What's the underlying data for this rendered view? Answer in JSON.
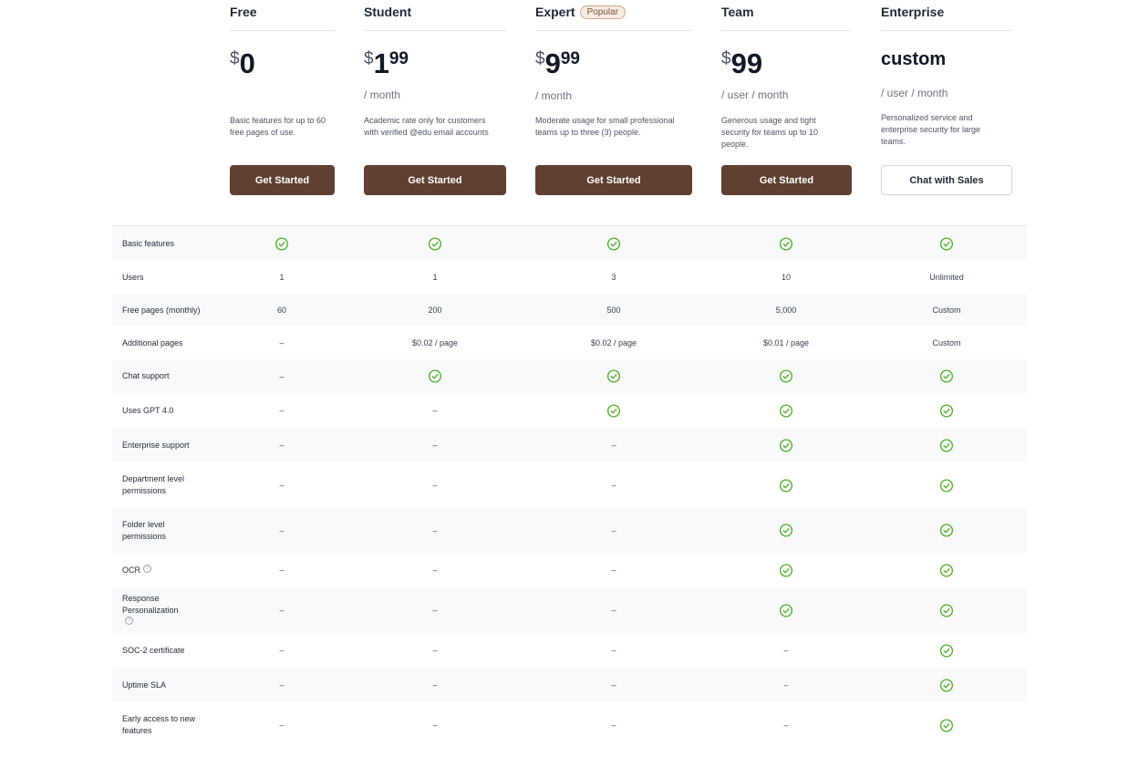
{
  "plans": [
    {
      "name": "Free",
      "badge": "",
      "currency": "$",
      "price_int": "0",
      "price_cents": "",
      "price_text": "",
      "period": "",
      "description": "Basic features for up to 60 free pages of use.",
      "cta": "Get Started",
      "cta_style": "primary"
    },
    {
      "name": "Student",
      "badge": "",
      "currency": "$",
      "price_int": "1",
      "price_cents": "99",
      "price_text": "",
      "period": "/ month",
      "description": "Academic rate only for customers with verified @edu email accounts",
      "cta": "Get Started",
      "cta_style": "primary"
    },
    {
      "name": "Expert",
      "badge": "Popular",
      "currency": "$",
      "price_int": "9",
      "price_cents": "99",
      "price_text": "",
      "period": "/ month",
      "description": "Moderate usage for small professional teams up to three (3) people.",
      "cta": "Get Started",
      "cta_style": "primary"
    },
    {
      "name": "Team",
      "badge": "",
      "currency": "$",
      "price_int": "99",
      "price_cents": "",
      "price_text": "",
      "period": "/ user / month",
      "description": "Generous usage and tight security for teams up to 10 people.",
      "cta": "Get Started",
      "cta_style": "primary"
    },
    {
      "name": "Enterprise",
      "badge": "",
      "currency": "",
      "price_int": "",
      "price_cents": "",
      "price_text": "custom",
      "period": "/ user / month",
      "description": "Personalized service and enterprise security for large teams.",
      "cta": "Chat with Sales",
      "cta_style": "outline"
    }
  ],
  "features": [
    {
      "name": "Basic features",
      "info": false,
      "values": [
        "check",
        "check",
        "check",
        "check",
        "check"
      ]
    },
    {
      "name": "Users",
      "info": false,
      "values": [
        "1",
        "1",
        "3",
        "10",
        "Unlimited"
      ]
    },
    {
      "name": "Free pages (monthly)",
      "info": false,
      "values": [
        "60",
        "200",
        "500",
        "5,000",
        "Custom"
      ]
    },
    {
      "name": "Additional pages",
      "info": false,
      "values": [
        "–",
        "$0.02 / page",
        "$0.02 / page",
        "$0.01 / page",
        "Custom"
      ]
    },
    {
      "name": "Chat support",
      "info": false,
      "values": [
        "–",
        "check",
        "check",
        "check",
        "check"
      ]
    },
    {
      "name": "Uses GPT 4.0",
      "info": false,
      "values": [
        "–",
        "–",
        "check",
        "check",
        "check"
      ]
    },
    {
      "name": "Enterprise support",
      "info": false,
      "values": [
        "–",
        "–",
        "–",
        "check",
        "check"
      ]
    },
    {
      "name": "Department level permissions",
      "info": false,
      "values": [
        "–",
        "–",
        "–",
        "check",
        "check"
      ]
    },
    {
      "name": "Folder level permissions",
      "info": false,
      "values": [
        "–",
        "–",
        "–",
        "check",
        "check"
      ]
    },
    {
      "name": "OCR",
      "info": true,
      "values": [
        "–",
        "–",
        "–",
        "check",
        "check"
      ]
    },
    {
      "name": "Response Personalization",
      "info": true,
      "values": [
        "–",
        "–",
        "–",
        "check",
        "check"
      ]
    },
    {
      "name": "SOC-2 certificate",
      "info": false,
      "values": [
        "–",
        "–",
        "–",
        "–",
        "check"
      ]
    },
    {
      "name": "Uptime SLA",
      "info": false,
      "values": [
        "–",
        "–",
        "–",
        "–",
        "check"
      ]
    },
    {
      "name": "Early access to new features",
      "info": false,
      "values": [
        "–",
        "–",
        "–",
        "–",
        "check"
      ]
    }
  ],
  "colors": {
    "accent": "#5f4031",
    "check": "#4caf23",
    "row_alt": "#f8f9fa"
  },
  "icons": {
    "check": "check-circle-icon",
    "info": "info-icon"
  }
}
